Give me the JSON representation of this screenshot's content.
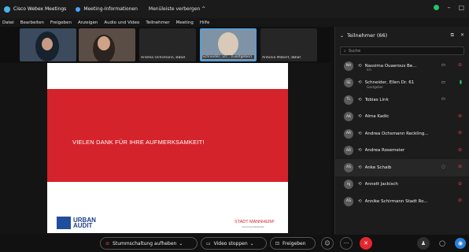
{
  "titlebar": {
    "app_title": "Cisco Webex Meetings",
    "meeting_info": "Meeting-Informationen",
    "hidden_bar": "Menüleiste verbergen ^",
    "minimize": "–",
    "maximize": "□"
  },
  "menu": [
    "Datei",
    "Bearbeiten",
    "Freigeben",
    "Anzeigen",
    "Audio und Video",
    "Teilnehmer",
    "Meeting",
    "Hilfe"
  ],
  "video_strip": {
    "tiles": [
      {
        "name": ""
      },
      {
        "name": ""
      },
      {
        "name": "Andrea Ochsmann, BBSR"
      },
      {
        "name": "Schneider, Ell... (Gastgeber)"
      },
      {
        "name": "Antonia Milbert, BBSR"
      }
    ]
  },
  "slide": {
    "headline": "VIELEN DANK FÜR IHRE AUFMERKSAMKEIT!",
    "logo_left": [
      "URBAN",
      "AUDIT"
    ],
    "logo_right": "STADT MANNHEIM²",
    "logo_right_sub": "Kommunalstatistik"
  },
  "participants": {
    "title": "Teilnehmer (66)",
    "search_placeholder": "Suche",
    "items": [
      {
        "initials": "NA",
        "name": "Nassima Ouaerous Be...",
        "sub": "Ich",
        "right": "video",
        "mic": "muted"
      },
      {
        "initials": "SE",
        "name": "Schneider, Ellen Dr. 61",
        "sub": "Gastgeber",
        "right": "video",
        "mic": "active"
      },
      {
        "initials": "TL",
        "name": "Tobias Link",
        "sub": "",
        "right": "video",
        "mic": ""
      },
      {
        "initials": "AK",
        "name": "Alma Kadic",
        "sub": "",
        "right": "",
        "mic": "muted"
      },
      {
        "initials": "AR",
        "name": "Andrea Ochsmann Reckling...",
        "sub": "",
        "right": "",
        "mic": "muted"
      },
      {
        "initials": "AR",
        "name": "Andrea Rosemeier",
        "sub": "",
        "right": "",
        "mic": "muted"
      },
      {
        "initials": "AS",
        "name": "Anke Schaib",
        "sub": "",
        "right": "chat",
        "mic": "muted"
      },
      {
        "initials": "AJ",
        "name": "Annett Jackisch",
        "sub": "",
        "right": "",
        "mic": "muted"
      },
      {
        "initials": "AS",
        "name": "Annike Schirmann Stadt Ro...",
        "sub": "",
        "right": "",
        "mic": "muted"
      }
    ]
  },
  "bottombar": {
    "unmute_label": "Stummschaltung aufheben",
    "video_label": "Video stoppen",
    "share_label": "Freigeben"
  },
  "colors": {
    "accent": "#39a3ff",
    "slide_red": "#d5232b",
    "mute_red": "#e5484d",
    "leave_red": "#e5262f",
    "online_green": "#27c26a"
  }
}
